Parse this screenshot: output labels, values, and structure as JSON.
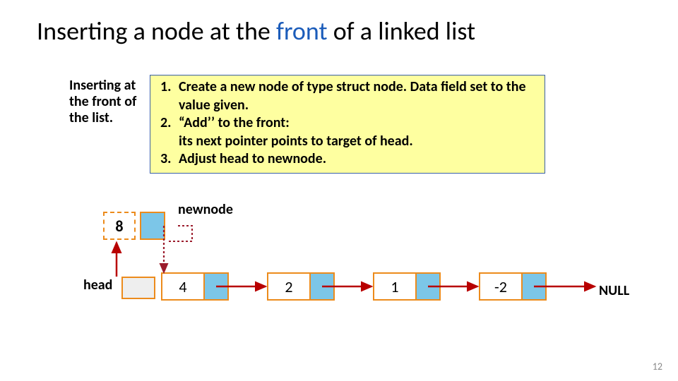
{
  "title": {
    "pre": "Inserting a node at the ",
    "accent": "front",
    "post": " of a linked list"
  },
  "caption": "Inserting at the front of the list.",
  "steps": {
    "s1": "Create a new node of type struct node. Data field set to the value given.",
    "s2": "“Add’’ to the front:",
    "s2sub": "its next pointer points to target of head.",
    "s3": "Adjust head to newnode."
  },
  "labels": {
    "newnode": "newnode",
    "head": "head",
    "null": "NULL"
  },
  "newnode_value": "8",
  "nodes": [
    "4",
    "2",
    "1",
    "-2"
  ],
  "pagenum": "12"
}
